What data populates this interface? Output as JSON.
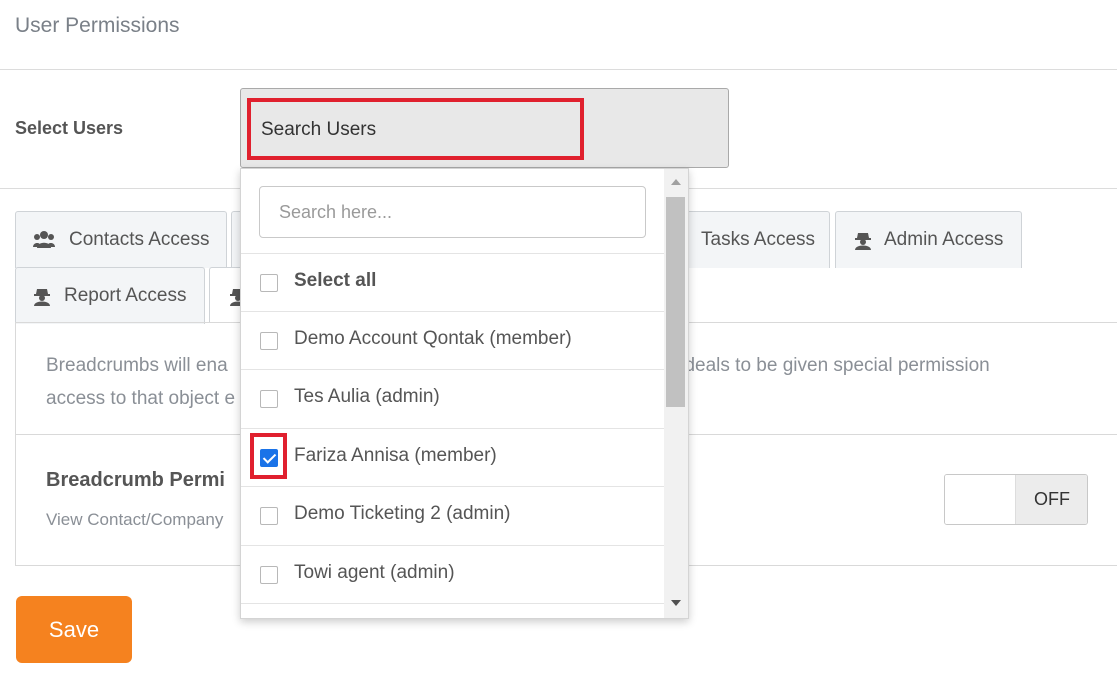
{
  "header": {
    "title": "User Permissions"
  },
  "select_users": {
    "label": "Select Users",
    "value": "Search Users"
  },
  "tabs": [
    {
      "label": "Contacts Access",
      "icon": "users-icon"
    },
    {
      "label": "Tasks Access",
      "icon": "agent-icon"
    },
    {
      "label": "Admin Access",
      "icon": "agent-icon"
    },
    {
      "label": "Report Access",
      "icon": "agent-icon"
    }
  ],
  "panel": {
    "description_left": "Breadcrumbs will ena",
    "description_right": "d deals to be given special permission",
    "description_line2": "access to that object e",
    "permission_title": "Breadcrumb Permi",
    "permission_subtitle": "View Contact/Company",
    "toggle_state": "OFF"
  },
  "dropdown": {
    "search_placeholder": "Search here...",
    "select_all_label": "Select all",
    "options": [
      {
        "label": "Demo Account Qontak (member)",
        "checked": false
      },
      {
        "label": "Tes Aulia (admin)",
        "checked": false
      },
      {
        "label": "Fariza Annisa (member)",
        "checked": true
      },
      {
        "label": "Demo Ticketing 2 (admin)",
        "checked": false
      },
      {
        "label": "Towi agent (admin)",
        "checked": false
      }
    ]
  },
  "actions": {
    "save_label": "Save"
  },
  "colors": {
    "accent": "#f5821f",
    "checkbox_checked": "#1a73e8",
    "highlight": "#e0202e"
  }
}
